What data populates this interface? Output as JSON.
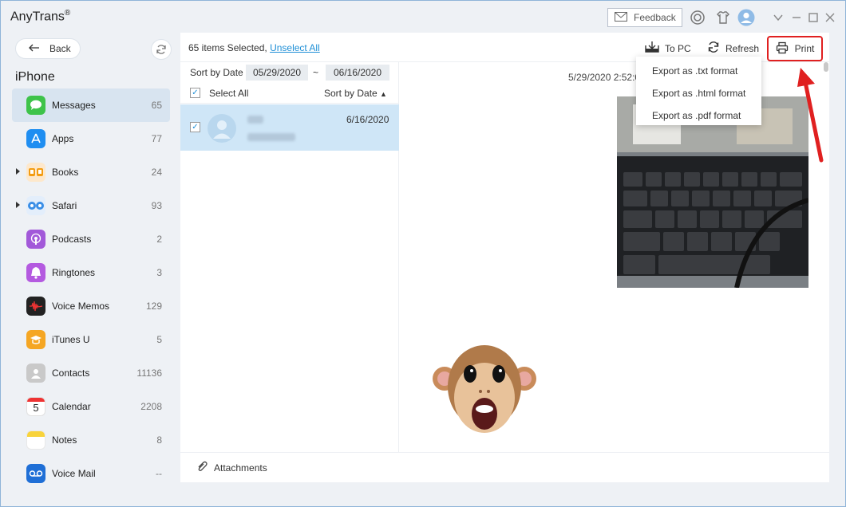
{
  "app": {
    "name": "AnyTrans",
    "reg": "®"
  },
  "titlebar": {
    "feedback_label": "Feedback"
  },
  "sidebar": {
    "back_label": "Back",
    "device_name": "iPhone",
    "items": [
      {
        "label": "Messages",
        "count": "65",
        "icon": "messages-icon",
        "color": "#3ec34a",
        "expandable": false,
        "active": true
      },
      {
        "label": "Apps",
        "count": "77",
        "icon": "apps-icon",
        "color": "#1f8ef1",
        "expandable": false,
        "active": false
      },
      {
        "label": "Books",
        "count": "24",
        "icon": "books-icon",
        "color": "#f39c12",
        "expandable": true,
        "active": false
      },
      {
        "label": "Safari",
        "count": "93",
        "icon": "safari-icon",
        "color": "#3a8ee6",
        "expandable": true,
        "active": false
      },
      {
        "label": "Podcasts",
        "count": "2",
        "icon": "podcasts-icon",
        "color": "#a259d9",
        "expandable": false,
        "active": false
      },
      {
        "label": "Ringtones",
        "count": "3",
        "icon": "ringtones-icon",
        "color": "#b45ae0",
        "expandable": false,
        "active": false
      },
      {
        "label": "Voice Memos",
        "count": "129",
        "icon": "voice-memos-icon",
        "color": "#222222",
        "expandable": false,
        "active": false
      },
      {
        "label": "iTunes U",
        "count": "5",
        "icon": "itunes-u-icon",
        "color": "#f5a623",
        "expandable": false,
        "active": false
      },
      {
        "label": "Contacts",
        "count": "11136",
        "icon": "contacts-icon",
        "color": "#9a9a9a",
        "expandable": false,
        "active": false
      },
      {
        "label": "Calendar",
        "count": "2208",
        "icon": "calendar-icon",
        "color": "#ffffff",
        "expandable": false,
        "active": false
      },
      {
        "label": "Notes",
        "count": "8",
        "icon": "notes-icon",
        "color": "#f8d33b",
        "expandable": false,
        "active": false
      },
      {
        "label": "Voice Mail",
        "count": "--",
        "icon": "voice-mail-icon",
        "color": "#1f6fd6",
        "expandable": false,
        "active": false
      }
    ],
    "calendar_day": "5"
  },
  "toolbar": {
    "selected_text": "65 items Selected,",
    "unselect_label": "Unselect All",
    "to_pc_label": "To PC",
    "refresh_label": "Refresh",
    "print_label": "Print"
  },
  "list": {
    "sort_label": "Sort by Date",
    "date_from": "05/29/2020",
    "date_sep": "~",
    "date_to": "06/16/2020",
    "select_all_label": "Select All",
    "sort_by_label": "Sort by Date",
    "rows": [
      {
        "date": "6/16/2020",
        "checked": true
      }
    ]
  },
  "preview": {
    "timestamp": "5/29/2020 2:52:0"
  },
  "attachments_label": "Attachments",
  "export_menu": {
    "items": [
      "Export as .txt format",
      "Export as .html format",
      "Export as .pdf format"
    ]
  },
  "colors": {
    "accent": "#1f8fd6",
    "highlight": "#e02020",
    "selected_row": "#cfe6f7",
    "active_nav": "#d8e4f0"
  }
}
